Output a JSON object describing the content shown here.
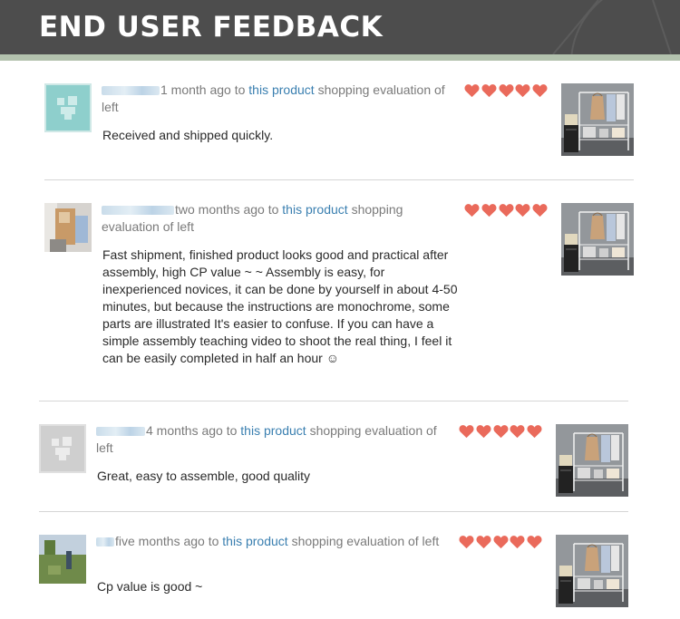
{
  "header": {
    "title": "END USER FEEDBACK"
  },
  "accent_colors": {
    "heart": "#ea6a5b",
    "link": "#3a7fb0",
    "header_bg": "#4d4d4d",
    "stripe": "#b3c2ae"
  },
  "reviews": [
    {
      "time_phrase": "1 month ago to",
      "product_link": "this product",
      "evaluation_text": "shopping evaluation of left",
      "comment": "Received and shipped quickly.",
      "rating": 5
    },
    {
      "time_phrase": "two months ago to",
      "product_link": "this product",
      "evaluation_text": "shopping evaluation of left",
      "comment": "Fast shipment, finished product looks good and practical after assembly, high CP value ~ ~ Assembly is easy, for inexperienced novices, it can be done by yourself in about 4-50 minutes, but because the instructions are monochrome, some parts are illustrated It's easier to confuse. If you can have a simple assembly teaching video to shoot the real thing, I feel it can be easily completed in half an hour ☺",
      "rating": 5
    },
    {
      "time_phrase": "4 months ago to",
      "product_link": "this product",
      "evaluation_text": "shopping evaluation of left",
      "comment": "Great, easy to assemble, good quality",
      "rating": 5
    },
    {
      "time_phrase": "five months ago to",
      "product_link": "this product",
      "evaluation_text": "shopping evaluation of left",
      "comment": "Cp value is good ~",
      "rating": 5
    }
  ]
}
